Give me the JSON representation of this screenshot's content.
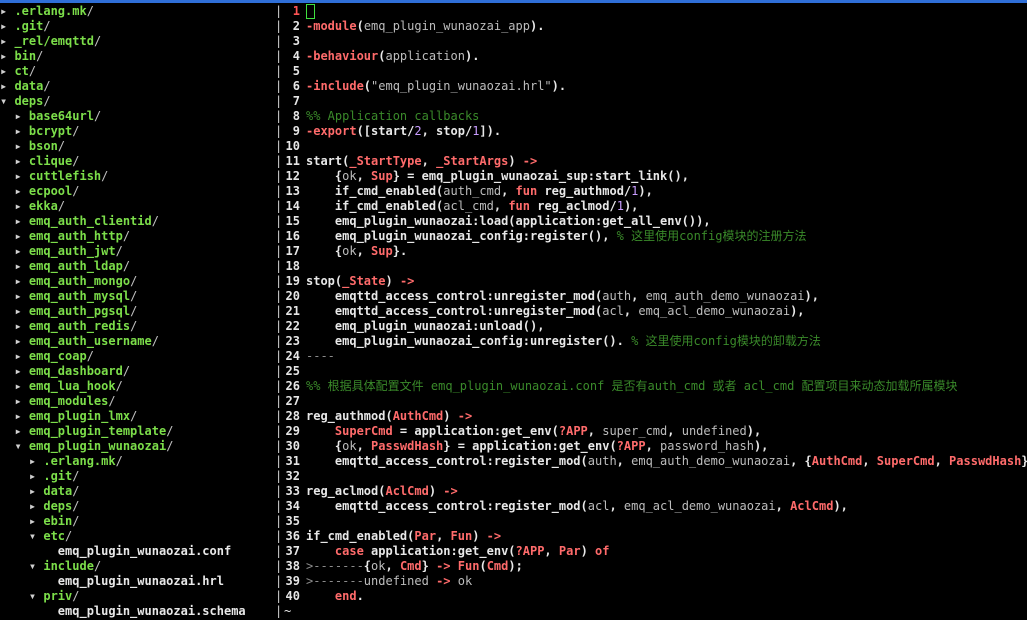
{
  "tree": [
    {
      "depth": 0,
      "name": ".erlang.mk",
      "type": "dir",
      "open": false
    },
    {
      "depth": 0,
      "name": ".git",
      "type": "dir",
      "open": false
    },
    {
      "depth": 0,
      "name": "_rel/emqttd",
      "type": "dir",
      "open": false
    },
    {
      "depth": 0,
      "name": "bin",
      "type": "dir",
      "open": false
    },
    {
      "depth": 0,
      "name": "ct",
      "type": "dir",
      "open": false
    },
    {
      "depth": 0,
      "name": "data",
      "type": "dir",
      "open": false
    },
    {
      "depth": 0,
      "name": "deps",
      "type": "dir",
      "open": true
    },
    {
      "depth": 1,
      "name": "base64url",
      "type": "dir",
      "open": false
    },
    {
      "depth": 1,
      "name": "bcrypt",
      "type": "dir",
      "open": false
    },
    {
      "depth": 1,
      "name": "bson",
      "type": "dir",
      "open": false
    },
    {
      "depth": 1,
      "name": "clique",
      "type": "dir",
      "open": false
    },
    {
      "depth": 1,
      "name": "cuttlefish",
      "type": "dir",
      "open": false
    },
    {
      "depth": 1,
      "name": "ecpool",
      "type": "dir",
      "open": false
    },
    {
      "depth": 1,
      "name": "ekka",
      "type": "dir",
      "open": false
    },
    {
      "depth": 1,
      "name": "emq_auth_clientid",
      "type": "dir",
      "open": false
    },
    {
      "depth": 1,
      "name": "emq_auth_http",
      "type": "dir",
      "open": false
    },
    {
      "depth": 1,
      "name": "emq_auth_jwt",
      "type": "dir",
      "open": false
    },
    {
      "depth": 1,
      "name": "emq_auth_ldap",
      "type": "dir",
      "open": false
    },
    {
      "depth": 1,
      "name": "emq_auth_mongo",
      "type": "dir",
      "open": false
    },
    {
      "depth": 1,
      "name": "emq_auth_mysql",
      "type": "dir",
      "open": false
    },
    {
      "depth": 1,
      "name": "emq_auth_pgsql",
      "type": "dir",
      "open": false
    },
    {
      "depth": 1,
      "name": "emq_auth_redis",
      "type": "dir",
      "open": false
    },
    {
      "depth": 1,
      "name": "emq_auth_username",
      "type": "dir",
      "open": false
    },
    {
      "depth": 1,
      "name": "emq_coap",
      "type": "dir",
      "open": false
    },
    {
      "depth": 1,
      "name": "emq_dashboard",
      "type": "dir",
      "open": false
    },
    {
      "depth": 1,
      "name": "emq_lua_hook",
      "type": "dir",
      "open": false
    },
    {
      "depth": 1,
      "name": "emq_modules",
      "type": "dir",
      "open": false
    },
    {
      "depth": 1,
      "name": "emq_plugin_lmx",
      "type": "dir",
      "open": false
    },
    {
      "depth": 1,
      "name": "emq_plugin_template",
      "type": "dir",
      "open": false
    },
    {
      "depth": 1,
      "name": "emq_plugin_wunaozai",
      "type": "dir",
      "open": true
    },
    {
      "depth": 2,
      "name": ".erlang.mk",
      "type": "dir",
      "open": false
    },
    {
      "depth": 2,
      "name": ".git",
      "type": "dir",
      "open": false
    },
    {
      "depth": 2,
      "name": "data",
      "type": "dir",
      "open": false
    },
    {
      "depth": 2,
      "name": "deps",
      "type": "dir",
      "open": false
    },
    {
      "depth": 2,
      "name": "ebin",
      "type": "dir",
      "open": false
    },
    {
      "depth": 2,
      "name": "etc",
      "type": "dir",
      "open": true
    },
    {
      "depth": 3,
      "name": "emq_plugin_wunaozai.conf",
      "type": "file"
    },
    {
      "depth": 2,
      "name": "include",
      "type": "dir",
      "open": true
    },
    {
      "depth": 3,
      "name": "emq_plugin_wunaozai.hrl",
      "type": "file"
    },
    {
      "depth": 2,
      "name": "priv",
      "type": "dir",
      "open": true
    },
    {
      "depth": 3,
      "name": "emq_plugin_wunaozai.schema",
      "type": "file"
    }
  ],
  "separator": "|",
  "cursor_line": 1,
  "lines": [
    {
      "n": "1",
      "tokens": []
    },
    {
      "n": "2",
      "tokens": [
        [
          "kw",
          "-module"
        ],
        [
          "",
          "("
        ],
        [
          "atom",
          "emq_plugin_wunaozai_app"
        ],
        [
          "",
          ")."
        ]
      ]
    },
    {
      "n": "3",
      "tokens": []
    },
    {
      "n": "4",
      "tokens": [
        [
          "kw",
          "-behaviour"
        ],
        [
          "",
          "("
        ],
        [
          "atom",
          "application"
        ],
        [
          "",
          ")."
        ]
      ]
    },
    {
      "n": "5",
      "tokens": []
    },
    {
      "n": "6",
      "tokens": [
        [
          "kw",
          "-include"
        ],
        [
          "",
          "("
        ],
        [
          "str",
          "\"emq_plugin_wunaozai.hrl\""
        ],
        [
          "",
          ")."
        ]
      ]
    },
    {
      "n": "7",
      "tokens": []
    },
    {
      "n": "8",
      "tokens": [
        [
          "cmt",
          "%% Application callbacks"
        ]
      ]
    },
    {
      "n": "9",
      "tokens": [
        [
          "kw",
          "-export"
        ],
        [
          "",
          "([start/"
        ],
        [
          "num",
          "2"
        ],
        [
          "",
          ", stop/"
        ],
        [
          "num",
          "1"
        ],
        [
          "",
          "])."
        ]
      ]
    },
    {
      "n": "10",
      "tokens": []
    },
    {
      "n": "11",
      "tokens": [
        [
          "",
          "start("
        ],
        [
          "var",
          "_StartType"
        ],
        [
          "",
          ", "
        ],
        [
          "var",
          "_StartArgs"
        ],
        [
          "",
          ") "
        ],
        [
          "kw",
          "->"
        ]
      ]
    },
    {
      "n": "12",
      "tokens": [
        [
          "",
          "    {"
        ],
        [
          "atom",
          "ok"
        ],
        [
          "",
          ", "
        ],
        [
          "var",
          "Sup"
        ],
        [
          "",
          "} = emq_plugin_wunaozai_sup:start_link(),"
        ]
      ]
    },
    {
      "n": "13",
      "tokens": [
        [
          "",
          "    if_cmd_enabled("
        ],
        [
          "atom",
          "auth_cmd"
        ],
        [
          "",
          ", "
        ],
        [
          "kw",
          "fun"
        ],
        [
          "",
          " reg_authmod/"
        ],
        [
          "num",
          "1"
        ],
        [
          "",
          "),"
        ]
      ]
    },
    {
      "n": "14",
      "tokens": [
        [
          "",
          "    if_cmd_enabled("
        ],
        [
          "atom",
          "acl_cmd"
        ],
        [
          "",
          ", "
        ],
        [
          "kw",
          "fun"
        ],
        [
          "",
          " reg_aclmod/"
        ],
        [
          "num",
          "1"
        ],
        [
          "",
          "),"
        ]
      ]
    },
    {
      "n": "15",
      "tokens": [
        [
          "",
          "    emq_plugin_wunaozai:load(application:get_all_env()),"
        ]
      ]
    },
    {
      "n": "16",
      "tokens": [
        [
          "",
          "    emq_plugin_wunaozai_config:register(), "
        ],
        [
          "cmt",
          "% 这里使用config模块的注册方法"
        ]
      ]
    },
    {
      "n": "17",
      "tokens": [
        [
          "",
          "    {"
        ],
        [
          "atom",
          "ok"
        ],
        [
          "",
          ", "
        ],
        [
          "var",
          "Sup"
        ],
        [
          "",
          "}."
        ]
      ]
    },
    {
      "n": "18",
      "tokens": []
    },
    {
      "n": "19",
      "tokens": [
        [
          "",
          "stop("
        ],
        [
          "var",
          "_State"
        ],
        [
          "",
          ") "
        ],
        [
          "kw",
          "->"
        ]
      ]
    },
    {
      "n": "20",
      "tokens": [
        [
          "",
          "    emqttd_access_control:unregister_mod("
        ],
        [
          "atom",
          "auth"
        ],
        [
          "",
          ", "
        ],
        [
          "atom",
          "emq_auth_demo_wunaozai"
        ],
        [
          "",
          "),"
        ]
      ]
    },
    {
      "n": "21",
      "tokens": [
        [
          "",
          "    emqttd_access_control:unregister_mod("
        ],
        [
          "atom",
          "acl"
        ],
        [
          "",
          ", "
        ],
        [
          "atom",
          "emq_acl_demo_wunaozai"
        ],
        [
          "",
          "),"
        ]
      ]
    },
    {
      "n": "22",
      "tokens": [
        [
          "",
          "    emq_plugin_wunaozai:unload(),"
        ]
      ]
    },
    {
      "n": "23",
      "tokens": [
        [
          "",
          "    emq_plugin_wunaozai_config:unregister(). "
        ],
        [
          "cmt",
          "% 这里使用config模块的卸载方法"
        ]
      ]
    },
    {
      "n": "24",
      "tokens": [
        [
          "lt",
          "----"
        ]
      ]
    },
    {
      "n": "25",
      "tokens": []
    },
    {
      "n": "26",
      "tokens": [
        [
          "cmt",
          "%% 根据具体配置文件 emq_plugin_wunaozai.conf 是否有auth_cmd 或者 acl_cmd 配置项目来动态加载所属模块"
        ]
      ]
    },
    {
      "n": "27",
      "tokens": []
    },
    {
      "n": "28",
      "tokens": [
        [
          "",
          "reg_authmod("
        ],
        [
          "var",
          "AuthCmd"
        ],
        [
          "",
          ") "
        ],
        [
          "kw",
          "->"
        ]
      ]
    },
    {
      "n": "29",
      "tokens": [
        [
          "var",
          "    SuperCmd"
        ],
        [
          "",
          " = application:get_env("
        ],
        [
          "var",
          "?APP"
        ],
        [
          "",
          ", "
        ],
        [
          "atom",
          "super_cmd"
        ],
        [
          "",
          ", "
        ],
        [
          "atom",
          "undefined"
        ],
        [
          "",
          "),"
        ]
      ]
    },
    {
      "n": "30",
      "tokens": [
        [
          "",
          "    {"
        ],
        [
          "atom",
          "ok"
        ],
        [
          "",
          ", "
        ],
        [
          "var",
          "PasswdHash"
        ],
        [
          "",
          "} = application:get_env("
        ],
        [
          "var",
          "?APP"
        ],
        [
          "",
          ", "
        ],
        [
          "atom",
          "password_hash"
        ],
        [
          "",
          "),"
        ]
      ]
    },
    {
      "n": "31",
      "tokens": [
        [
          "",
          "    emqttd_access_control:register_mod("
        ],
        [
          "atom",
          "auth"
        ],
        [
          "",
          ", "
        ],
        [
          "atom",
          "emq_auth_demo_wunaozai"
        ],
        [
          "",
          ", {"
        ],
        [
          "var",
          "AuthCmd"
        ],
        [
          "",
          ", "
        ],
        [
          "var",
          "SuperCmd"
        ],
        [
          "",
          ", "
        ],
        [
          "var",
          "PasswdHash"
        ],
        [
          "",
          "})."
        ]
      ]
    },
    {
      "n": "32",
      "tokens": []
    },
    {
      "n": "33",
      "tokens": [
        [
          "",
          "reg_aclmod("
        ],
        [
          "var",
          "AclCmd"
        ],
        [
          "",
          ") "
        ],
        [
          "kw",
          "->"
        ]
      ]
    },
    {
      "n": "34",
      "tokens": [
        [
          "",
          "    emqttd_access_control:register_mod("
        ],
        [
          "atom",
          "acl"
        ],
        [
          "",
          ", "
        ],
        [
          "atom",
          "emq_acl_demo_wunaozai"
        ],
        [
          "",
          ", "
        ],
        [
          "var",
          "AclCmd"
        ],
        [
          "",
          "),"
        ]
      ]
    },
    {
      "n": "35",
      "tokens": []
    },
    {
      "n": "36",
      "tokens": [
        [
          "",
          "if_cmd_enabled("
        ],
        [
          "var",
          "Par"
        ],
        [
          "",
          ", "
        ],
        [
          "var",
          "Fun"
        ],
        [
          "",
          ") "
        ],
        [
          "kw",
          "->"
        ]
      ]
    },
    {
      "n": "37",
      "tokens": [
        [
          "kw",
          "    case"
        ],
        [
          "",
          " application:get_env("
        ],
        [
          "var",
          "?APP"
        ],
        [
          "",
          ", "
        ],
        [
          "var",
          "Par"
        ],
        [
          "",
          ") "
        ],
        [
          "kw",
          "of"
        ]
      ]
    },
    {
      "n": "38",
      "tokens": [
        [
          "lt",
          ">-------"
        ],
        [
          "",
          "{"
        ],
        [
          "atom",
          "ok"
        ],
        [
          "",
          ", "
        ],
        [
          "var",
          "Cmd"
        ],
        [
          "",
          "} "
        ],
        [
          "kw",
          "->"
        ],
        [
          "",
          " "
        ],
        [
          "var",
          "Fun"
        ],
        [
          "",
          "("
        ],
        [
          "var",
          "Cmd"
        ],
        [
          "",
          ");"
        ]
      ]
    },
    {
      "n": "39",
      "tokens": [
        [
          "lt",
          ">-------"
        ],
        [
          "atom",
          "undefined"
        ],
        [
          "",
          " "
        ],
        [
          "kw",
          "->"
        ],
        [
          "",
          " "
        ],
        [
          "atom",
          "ok"
        ]
      ]
    },
    {
      "n": "40",
      "tokens": [
        [
          "kw",
          "    end"
        ],
        [
          "",
          "."
        ]
      ]
    }
  ],
  "tilde": "~"
}
